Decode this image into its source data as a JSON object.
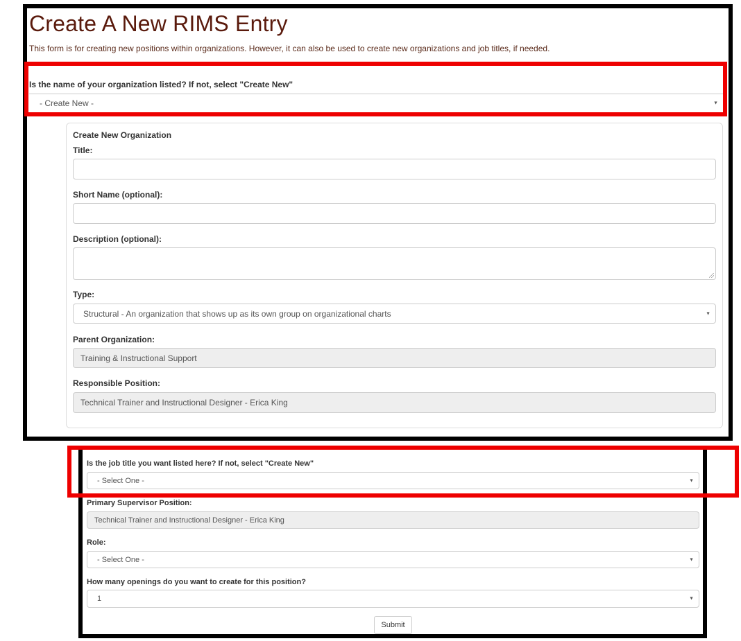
{
  "page": {
    "title": "Create A New RIMS Entry",
    "intro": "This form is for creating new positions within organizations. However, it can also be used to create new organizations and job titles, if needed."
  },
  "organization_select": {
    "label": "Is the name of your organization listed? If not, select \"Create New\"",
    "value": "- Create New -"
  },
  "new_organization": {
    "heading": "Create New Organization",
    "title_label": "Title:",
    "title_value": "",
    "short_name_label": "Short Name (optional):",
    "short_name_value": "",
    "description_label": "Description (optional):",
    "description_value": "",
    "type_label": "Type:",
    "type_value": "Structural - An organization that shows up as its own group on organizational charts",
    "parent_label": "Parent Organization:",
    "parent_value": "Training & Instructional Support",
    "responsible_label": "Responsible Position:",
    "responsible_value": "Technical Trainer and Instructional Designer - Erica King"
  },
  "position": {
    "job_title_label": "Is the job title you want listed here? If not, select \"Create New\"",
    "job_title_value": "- Select One -",
    "supervisor_label": "Primary Supervisor Position:",
    "supervisor_value": "Technical Trainer and Instructional Designer - Erica King",
    "role_label": "Role:",
    "role_value": "- Select One -",
    "openings_label": "How many openings do you want to create for this position?",
    "openings_value": "1",
    "submit_label": "Submit"
  },
  "icons": {
    "caret": "▼"
  },
  "colors": {
    "title": "#5a1a0c",
    "highlight_box": "#ee0000",
    "frame": "#000000",
    "readonly_bg": "#eeeeee"
  }
}
